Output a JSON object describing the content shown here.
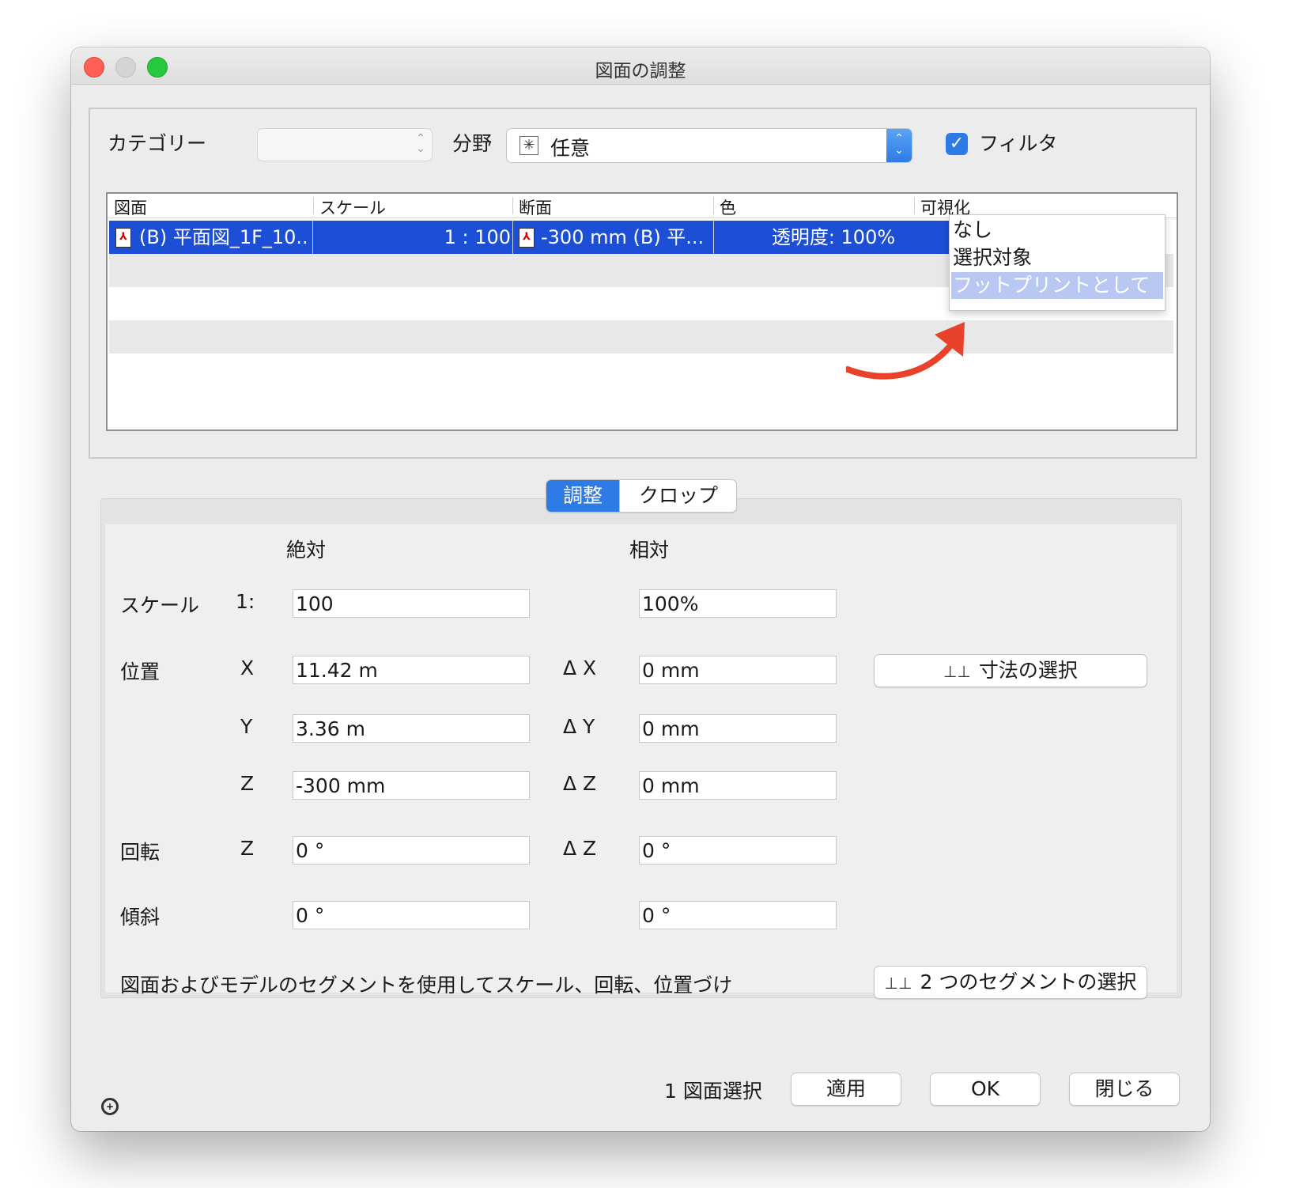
{
  "window": {
    "title": "図面の調整"
  },
  "filter_bar": {
    "category_label": "カテゴリー",
    "category_value": "",
    "field_label": "分野",
    "field_value": "任意",
    "filter_checkbox_label": "フィルタ",
    "filter_checked": true
  },
  "table": {
    "headers": [
      "図面",
      "スケール",
      "断面",
      "色",
      "可視化"
    ],
    "rows": [
      {
        "drawing": "(B) 平面図_1F_10...",
        "scale": "1 : 100",
        "section": "-300 mm (B) 平...",
        "color": "透明度: 100%",
        "selected": true
      }
    ]
  },
  "visualization_dropdown": {
    "options": [
      "なし",
      "選択対象",
      "フットプリントとして"
    ],
    "highlighted_index": 2
  },
  "tabs": [
    {
      "label": "調整",
      "active": true
    },
    {
      "label": "クロップ",
      "active": false
    }
  ],
  "adjust": {
    "col_absolute": "絶対",
    "col_relative": "相対",
    "scale": {
      "label": "スケール",
      "prefix": "1:",
      "absolute": "100",
      "relative": "100%"
    },
    "position": {
      "label": "位置",
      "x": {
        "axis": "X",
        "absolute": "11.42 m",
        "delta_label": "Δ X",
        "relative": "0 mm"
      },
      "y": {
        "axis": "Y",
        "absolute": "3.36 m",
        "delta_label": "Δ Y",
        "relative": "0 mm"
      },
      "z": {
        "axis": "Z",
        "absolute": "-300 mm",
        "delta_label": "Δ Z",
        "relative": "0 mm"
      }
    },
    "rotation": {
      "label": "回転",
      "axis": "Z",
      "absolute": "0 °",
      "delta_label": "Δ Z",
      "relative": "0 °"
    },
    "tilt": {
      "label": "傾斜",
      "absolute": "0 °",
      "relative": "0 °"
    },
    "select_dimension_button": "寸法の選択",
    "segments_hint": "図面およびモデルのセグメントを使用してスケール、回転、位置づけ",
    "select_segments_button": "2 つのセグメントの選択"
  },
  "footer": {
    "status": "1 図面選択",
    "apply_button": "適用",
    "ok_button": "OK",
    "close_button": "閉じる"
  },
  "colors": {
    "selection_blue": "#1c4fd6",
    "accent_blue": "#2f7be5",
    "annotation_arrow": "#e8432a",
    "dropdown_highlight": "#b9c8f2"
  }
}
